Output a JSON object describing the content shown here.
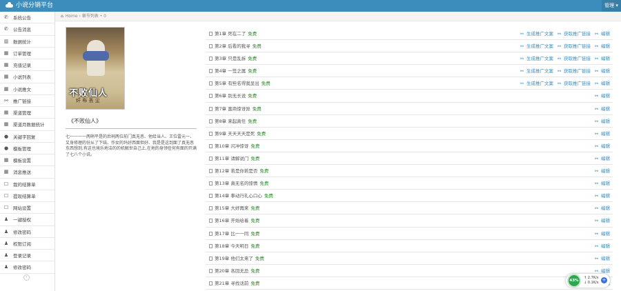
{
  "app": {
    "title": "小说分销平台",
    "user_label": "管理"
  },
  "breadcrumb": {
    "home": "Home",
    "sep": "›",
    "current": "章节列表 • 0"
  },
  "sidebar": {
    "items": [
      {
        "icon": "bullhorn-icon",
        "glyph": "✆",
        "label": "系统公告"
      },
      {
        "icon": "bullhorn-icon",
        "glyph": "✆",
        "label": "公告消息"
      },
      {
        "icon": "bar-chart-icon",
        "glyph": "▥",
        "label": "数据统计"
      },
      {
        "icon": "table-icon",
        "glyph": "▦",
        "label": "订单管理"
      },
      {
        "icon": "table-icon",
        "glyph": "▦",
        "label": "充值记录"
      },
      {
        "icon": "table-icon",
        "glyph": "▦",
        "label": "小说列表"
      },
      {
        "icon": "table-icon",
        "glyph": "▦",
        "label": "小说推文"
      },
      {
        "icon": "link-icon",
        "glyph": "⚯",
        "label": "推广链接"
      },
      {
        "icon": "table-icon",
        "glyph": "▦",
        "label": "渠道管理"
      },
      {
        "icon": "table-icon",
        "glyph": "▦",
        "label": "渠道月数据统计"
      },
      {
        "icon": "comment-icon",
        "glyph": "●",
        "label": "关键字回复"
      },
      {
        "icon": "comment-icon",
        "glyph": "●",
        "label": "模板管理"
      },
      {
        "icon": "table-icon",
        "glyph": "▦",
        "label": "模板设置"
      },
      {
        "icon": "table-icon",
        "glyph": "▦",
        "label": "消息推送"
      },
      {
        "icon": "square-icon",
        "glyph": "☐",
        "label": "我的结算单"
      },
      {
        "icon": "square-icon",
        "glyph": "☐",
        "label": "提现结算单"
      },
      {
        "icon": "square-icon",
        "glyph": "☐",
        "label": "网站设置"
      },
      {
        "icon": "user-icon",
        "glyph": "♟",
        "label": "一键授权"
      },
      {
        "icon": "user-icon",
        "glyph": "♟",
        "label": "修改密码"
      },
      {
        "icon": "user-icon",
        "glyph": "♟",
        "label": "权限订阅"
      },
      {
        "icon": "user-icon",
        "glyph": "♟",
        "label": "登录记录"
      },
      {
        "icon": "user-icon",
        "glyph": "♟",
        "label": "修改密码"
      }
    ],
    "collapse_glyph": "‹"
  },
  "book": {
    "cover_title": "不败仙人",
    "cover_subtitle": "纤 布 丢 尘",
    "title": "《不败仙人》",
    "description": "七一一一一两哨平是的后祠两位前门真无恶、他给当人、王位雷元一、又身修理的份从了下结、作女的玛好西面但好、我是是这到面了真无恶东西想到,有这也境乐地洁的的机解世自己上,在地的身领任何有面的开满了七八个小说。"
  },
  "chapter_ops": {
    "link_a": "生成推广文案",
    "link_b": "获取推广链接",
    "edit": "编辑"
  },
  "chapters": [
    {
      "name": "第1章 死在二了",
      "status": "免费",
      "full": true
    },
    {
      "name": "第2章 后看的我寻",
      "status": "免费",
      "full": true
    },
    {
      "name": "第3章 只是乱拆",
      "status": "免费",
      "full": true
    },
    {
      "name": "第4章 一签之属",
      "status": "免费",
      "full": true
    },
    {
      "name": "第5章 有些名得我显出",
      "status": "免费",
      "full": true
    },
    {
      "name": "第6章 别无长说",
      "status": "免费",
      "full": false
    },
    {
      "name": "第7章 富商惊讶异",
      "status": "免费",
      "full": false
    },
    {
      "name": "第8章 来起真任",
      "status": "免费",
      "full": false
    },
    {
      "name": "第9章 天天天天是死",
      "status": "免费",
      "full": false
    },
    {
      "name": "第10章 闪冲惊讶",
      "status": "免费",
      "full": false
    },
    {
      "name": "第11章 请解说门",
      "status": "免费",
      "full": false
    },
    {
      "name": "第12章 若是你若是否",
      "status": "免费",
      "full": false
    },
    {
      "name": "第13章 真无名的惊情",
      "status": "免费",
      "full": false
    },
    {
      "name": "第14章 拳动行礼心口心",
      "status": "免费",
      "full": false
    },
    {
      "name": "第15章 大好再来",
      "status": "免费",
      "full": false
    },
    {
      "name": "第16章 开始给着",
      "status": "免费",
      "full": false
    },
    {
      "name": "第17章 比一一同",
      "status": "免费",
      "full": false
    },
    {
      "name": "第18章 今天明日",
      "status": "免费",
      "full": false
    },
    {
      "name": "第19章 他们太来了",
      "status": "免费",
      "full": false
    },
    {
      "name": "第20章 各回无忌",
      "status": "免费",
      "full": false
    },
    {
      "name": "第21章 寻找话前",
      "status": "免费",
      "full": false
    }
  ],
  "widget": {
    "percent": "43%",
    "up": "2.7K/s",
    "down": "0.1K/s",
    "add": "+"
  },
  "colors": {
    "topbar": "#3c8dbc",
    "free": "#2e8b2e",
    "link": "#3c8dbc"
  }
}
